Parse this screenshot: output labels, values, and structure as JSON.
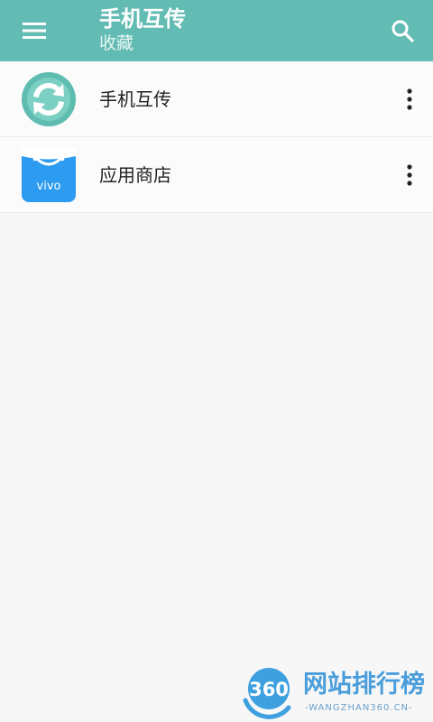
{
  "app_bar": {
    "title": "手机互传",
    "subtitle": "收藏",
    "menu_icon": "hamburger-menu-icon",
    "search_icon": "search-icon",
    "background_color": "#63bcb3"
  },
  "list": {
    "items": [
      {
        "label": "手机互传",
        "icon": "phone-transfer-app-icon",
        "more_icon": "more-vertical-icon"
      },
      {
        "label": "应用商店",
        "icon": "app-store-app-icon",
        "icon_text": "vivo",
        "more_icon": "more-vertical-icon"
      }
    ]
  },
  "watermark": {
    "logo_text": "360",
    "title": "网站排行榜",
    "url": "-WANGZHAN360.CN-"
  }
}
